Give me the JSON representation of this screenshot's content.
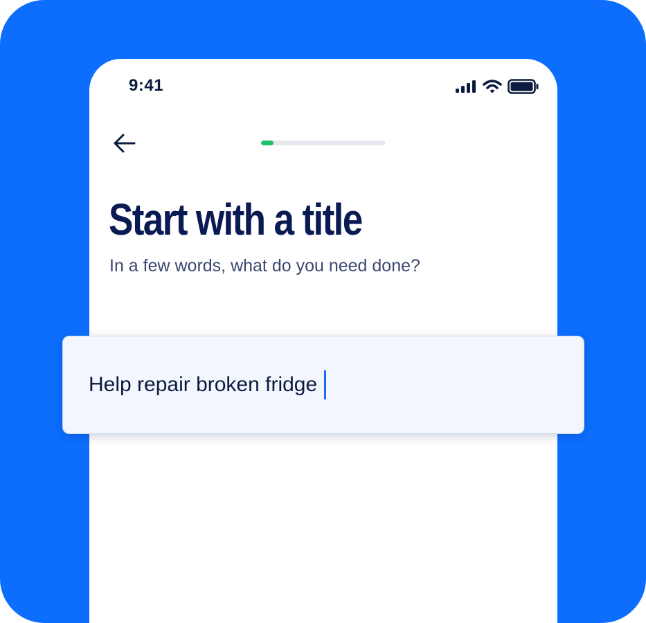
{
  "status_bar": {
    "time": "9:41",
    "icons": [
      "cellular-signal-icon",
      "wifi-icon",
      "battery-icon"
    ]
  },
  "nav": {
    "back_icon": "arrow-left-icon"
  },
  "progress": {
    "fraction": 0.1,
    "fill_color": "#1fc26b",
    "track_color": "#e6e8ef"
  },
  "main": {
    "title": "Start with a title",
    "subtitle": "In a few words, what do you need done?"
  },
  "title_input": {
    "value": "Help repair broken fridge"
  },
  "colors": {
    "background": "#0d6efd",
    "title": "#0a1a52",
    "caret": "#1b6cf0"
  }
}
